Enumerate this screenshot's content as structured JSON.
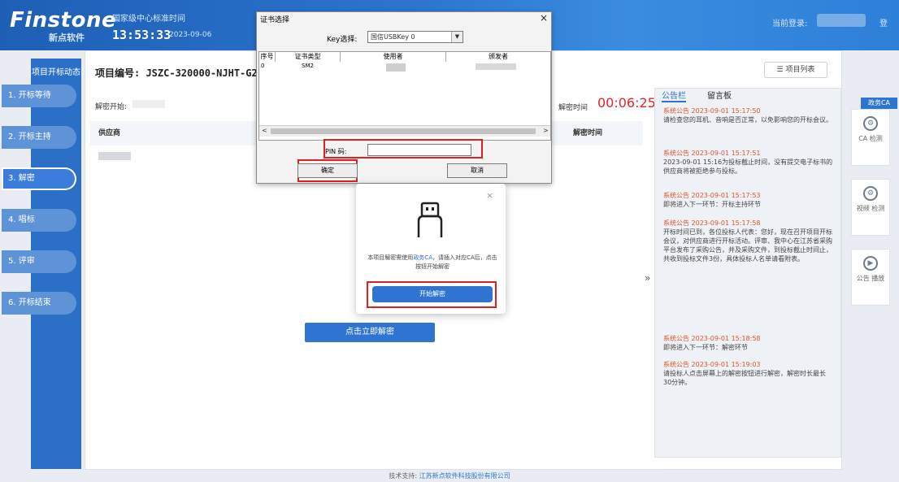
{
  "header": {
    "logo": "Finstone",
    "logo_sub": "新点软件",
    "center_name": "国家级中心标准时间",
    "clock": "13:53:33",
    "date": "2023-09-06",
    "login_label": "当前登录:",
    "logout": "登"
  },
  "sidebar": {
    "title": "项目开标动态",
    "steps": [
      "1. 开标等待",
      "2. 开标主持",
      "3. 解密",
      "4. 唱标",
      "5. 评审",
      "6. 开标结束"
    ]
  },
  "main": {
    "project_no": "项目编号: JSZC-320000-NJHT-G20",
    "list_btn": "☰ 项目列表",
    "decrypt_start": "解密开始:",
    "countdown_label": "解密时间",
    "countdown": "00:06:25",
    "col_supplier": "供应商",
    "col_time": "解密时间",
    "decrypt_now": "点击立即解密",
    "collapse": "»"
  },
  "bulletin": {
    "tab_notice": "公告栏",
    "tab_message": "留言板",
    "notices": [
      {
        "title": "系统公告 2023-09-01 15:17:50",
        "text": "请检查您的耳机、音响是否正常，以免影响您的开标会议。"
      },
      {
        "title": "系统公告 2023-09-01 15:17:51",
        "text": "2023-09-01 15:16为投标截止时间，没有提交电子标书的供应商将被拒绝参与投标。"
      },
      {
        "title": "系统公告 2023-09-01 15:17:53",
        "text": "即将进入下一环节：开标主持环节"
      },
      {
        "title": "系统公告 2023-09-01 15:17:58",
        "text": "开标时间已到，各位投标人代表：您好，现在召开项目开标会议，对供应商进行开标活动。评审、我中心在江苏省采购平台发布了采购公告，并及采购文件，到投标截止时间止，共收到投标文件3份，具体投标人名单请看附表。"
      },
      {
        "title": "系统公告 2023-09-01 15:18:58",
        "text": "即将进入下一环节：解密环节"
      },
      {
        "title": "系统公告 2023-09-01 15:19:03",
        "text": "请投标人点击屏幕上的解密按钮进行解密，解密时长最长30分钟。"
      }
    ]
  },
  "rail": {
    "tag": "政务CA",
    "items": [
      "CA 检测",
      "视频 检测",
      "公告 播放"
    ]
  },
  "footer": {
    "prefix": "技术支持:",
    "company": "江苏新点软件科技股份有限公司"
  },
  "cert_dialog": {
    "title": "证书选择",
    "close": "×",
    "key_label": "Key选择:",
    "key_value": "国信USBKey 0",
    "col_no": "序号",
    "col_type": "证书类型",
    "col_holder": "使用者",
    "col_issuer": "颁发者",
    "row_no": "0",
    "row_type": "SM2",
    "pin_label": "PIN 码:",
    "ok": "确定",
    "cancel": "取消"
  },
  "ca_modal": {
    "close": "×",
    "text_a": "本项目解密需使用",
    "text_hl": "政务CA",
    "text_b": "，请插入对应CA后，点击按钮开始解密",
    "button": "开始解密"
  },
  "colors": {
    "brand_blue": "#2f74d0",
    "alert_red": "#e0262b",
    "header_blue": "#1f5fb5"
  }
}
